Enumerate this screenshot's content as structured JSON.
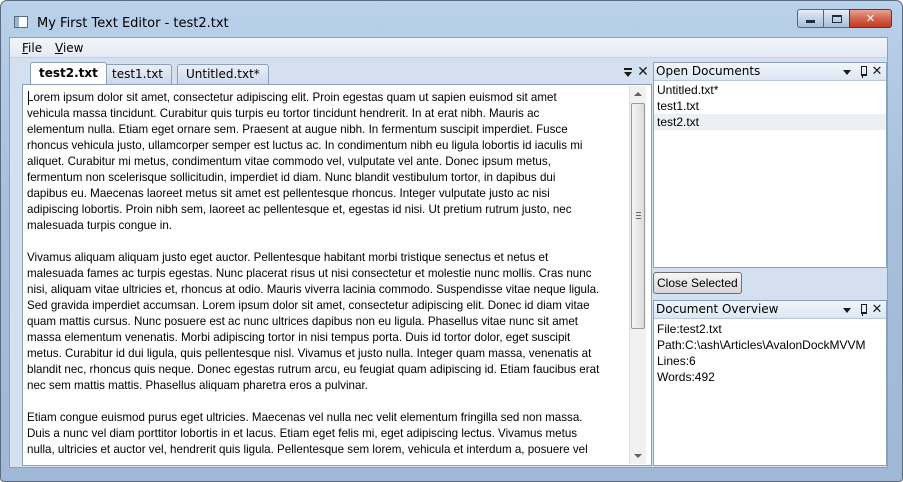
{
  "window": {
    "title": "My First Text Editor - test2.txt"
  },
  "menu": {
    "file_rest": "ile",
    "file_accel": "F",
    "view_accel": "V",
    "view_rest": "iew"
  },
  "tabs": [
    {
      "label": "test2.txt",
      "active": true
    },
    {
      "label": "test1.txt",
      "active": false
    },
    {
      "label": "Untitled.txt*",
      "active": false
    }
  ],
  "editor": {
    "text": "Lorem ipsum dolor sit amet, consectetur adipiscing elit. Proin egestas quam ut sapien euismod sit amet\nvehicula massa tincidunt. Curabitur quis turpis eu tortor tincidunt hendrerit. In at erat nibh. Mauris ac\nelementum nulla. Etiam eget ornare sem. Praesent at augue nibh. In fermentum suscipit imperdiet. Fusce\nrhoncus vehicula justo, ullamcorper semper est luctus ac. In condimentum nibh eu ligula lobortis id iaculis mi\naliquet. Curabitur mi metus, condimentum vitae commodo vel, vulputate vel ante. Donec ipsum metus,\nfermentum non scelerisque sollicitudin, imperdiet id diam. Nunc blandit vestibulum tortor, in dapibus dui\ndapibus eu. Maecenas laoreet metus sit amet est pellentesque rhoncus. Integer vulputate justo ac nisi\nadipiscing lobortis. Proin nibh sem, laoreet ac pellentesque et, egestas id nisi. Ut pretium rutrum justo, nec\nmalesuada turpis congue in.\n\nVivamus aliquam aliquam justo eget auctor. Pellentesque habitant morbi tristique senectus et netus et\nmalesuada fames ac turpis egestas. Nunc placerat risus ut nisi consectetur et molestie nunc mollis. Cras nunc\nnisi, aliquam vitae ultricies et, rhoncus at odio. Mauris viverra lacinia commodo. Suspendisse vitae neque ligula.\nSed gravida imperdiet accumsan. Lorem ipsum dolor sit amet, consectetur adipiscing elit. Donec id diam vitae\nquam mattis cursus. Nunc posuere est ac nunc ultrices dapibus non eu ligula. Phasellus vitae nunc sit amet\nmassa elementum venenatis. Morbi adipiscing tortor in nisi tempus porta. Duis id tortor dolor, eget suscipit\nmetus. Curabitur id dui ligula, quis pellentesque nisl. Vivamus et justo nulla. Integer quam massa, venenatis at\nblandit nec, rhoncus quis neque. Donec egestas rutrum arcu, eu feugiat quam adipiscing id. Etiam faucibus erat\nnec sem mattis mattis. Phasellus aliquam pharetra eros a pulvinar.\n\nEtiam congue euismod purus eget ultricies. Maecenas vel nulla nec velit elementum fringilla sed non massa.\nDuis a nunc vel diam porttitor lobortis in et lacus. Etiam eget felis mi, eget adipiscing lectus. Vivamus metus\nnulla, ultricies et auctor vel, hendrerit quis ligula. Pellentesque sem lorem, vehicula et interdum a, posuere vel"
  },
  "open_documents": {
    "title": "Open Documents",
    "items": [
      {
        "label": "Untitled.txt*",
        "selected": false
      },
      {
        "label": "test1.txt",
        "selected": false
      },
      {
        "label": "test2.txt",
        "selected": true
      }
    ],
    "close_button": "Close Selected"
  },
  "document_overview": {
    "title": "Document Overview",
    "file": "File:test2.txt",
    "path": "Path:C:\\ash\\Articles\\AvalonDockMVVM",
    "lines": "Lines:6",
    "words": "Words:492"
  }
}
